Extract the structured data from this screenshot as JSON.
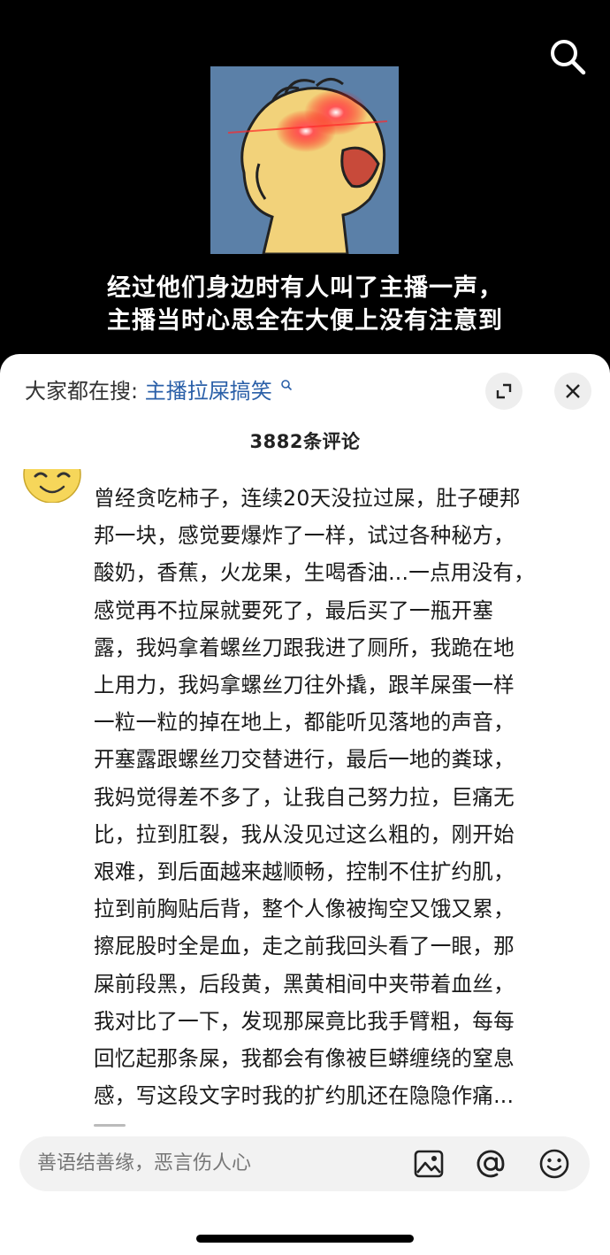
{
  "video": {
    "caption_lines": [
      "经过他们身边时有人叫了主播一声，",
      "主播当时心思全在大便上没有注意到"
    ],
    "search_icon": "search-icon",
    "thumbnail": "cartoon-character-glowing-red-eyes"
  },
  "sheet": {
    "trending_prefix": "大家都在搜:",
    "trending_keyword": "主播拉屎搞笑",
    "trending_icon": "search-icon",
    "expand_icon": "expand-icon",
    "close_icon": "close-icon",
    "comment_count": "3882条评论"
  },
  "comment": {
    "avatar": "emoji-face-avatar",
    "lines": [
      "曾经贪吃柿子，连续20天没拉过屎，肚子硬邦",
      "邦一块，感觉要爆炸了一样，试过各种秘方，",
      "酸奶，香蕉，火龙果，生喝香油...一点用没有，",
      "感觉再不拉屎就要死了，最后买了一瓶开塞",
      "露，我妈拿着螺丝刀跟我进了厕所，我跪在地",
      "上用力，我妈拿螺丝刀往外撬，跟羊屎蛋一样",
      "一粒一粒的掉在地上，都能听见落地的声音，",
      "开塞露跟螺丝刀交替进行，最后一地的粪球，",
      "我妈觉得差不多了，让我自己努力拉，巨痛无",
      "比，拉到肛裂，我从没见过这么粗的，刚开始",
      "艰难，到后面越来越顺畅，控制不住扩约肌，",
      "拉到前胸贴后背，整个人像被掏空又饿又累，",
      "擦屁股时全是血，走之前我回头看了一眼，那",
      "屎前段黑，后段黄，黑黄相间中夹带着血丝，",
      "我对比了一下，发现那屎竟比我手臂粗，每每",
      "回忆起那条屎，我都会有像被巨蟒缠绕的窒息",
      "感，写这段文字时我的扩约肌还在隐隐作痛..."
    ]
  },
  "input": {
    "placeholder": "善语结善缘，恶言伤人心",
    "icons": [
      "image-icon",
      "at-icon",
      "emoji-icon"
    ]
  },
  "colors": {
    "link": "#2a5fa8",
    "sheet_bg": "#ffffff",
    "input_bg": "#f2f2f2"
  }
}
